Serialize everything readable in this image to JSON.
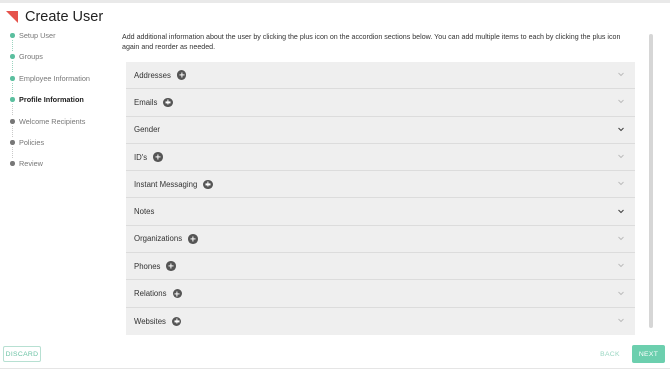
{
  "header": {
    "title": "Create User",
    "logo_icon": "red-triangle-logo"
  },
  "steps": [
    {
      "label": "Setup User",
      "state": "done"
    },
    {
      "label": "Groups",
      "state": "done"
    },
    {
      "label": "Employee Information",
      "state": "done"
    },
    {
      "label": "Profile Information",
      "state": "current"
    },
    {
      "label": "Welcome Recipients",
      "state": "todo"
    },
    {
      "label": "Policies",
      "state": "todo"
    },
    {
      "label": "Review",
      "state": "todo"
    }
  ],
  "intro": "Add additional information about the user by clicking the plus icon on the accordion sections below. You can add multiple items to each by clicking the plus icon again and reorder as needed.",
  "sections": [
    {
      "label": "Addresses",
      "has_add": true
    },
    {
      "label": "Emails",
      "has_add": true
    },
    {
      "label": "Gender",
      "has_add": false
    },
    {
      "label": "ID's",
      "has_add": true
    },
    {
      "label": "Instant Messaging",
      "has_add": true
    },
    {
      "label": "Notes",
      "has_add": false
    },
    {
      "label": "Organizations",
      "has_add": true
    },
    {
      "label": "Phones",
      "has_add": true
    },
    {
      "label": "Relations",
      "has_add": true
    },
    {
      "label": "Websites",
      "has_add": true
    }
  ],
  "footer": {
    "discard_label": "DISCARD",
    "back_label": "BACK",
    "next_label": "NEXT"
  },
  "colors": {
    "accent": "#6ccfae",
    "step_done": "#5bbf9f",
    "logo": "#e5534b",
    "accordion_bg": "#efefef"
  }
}
